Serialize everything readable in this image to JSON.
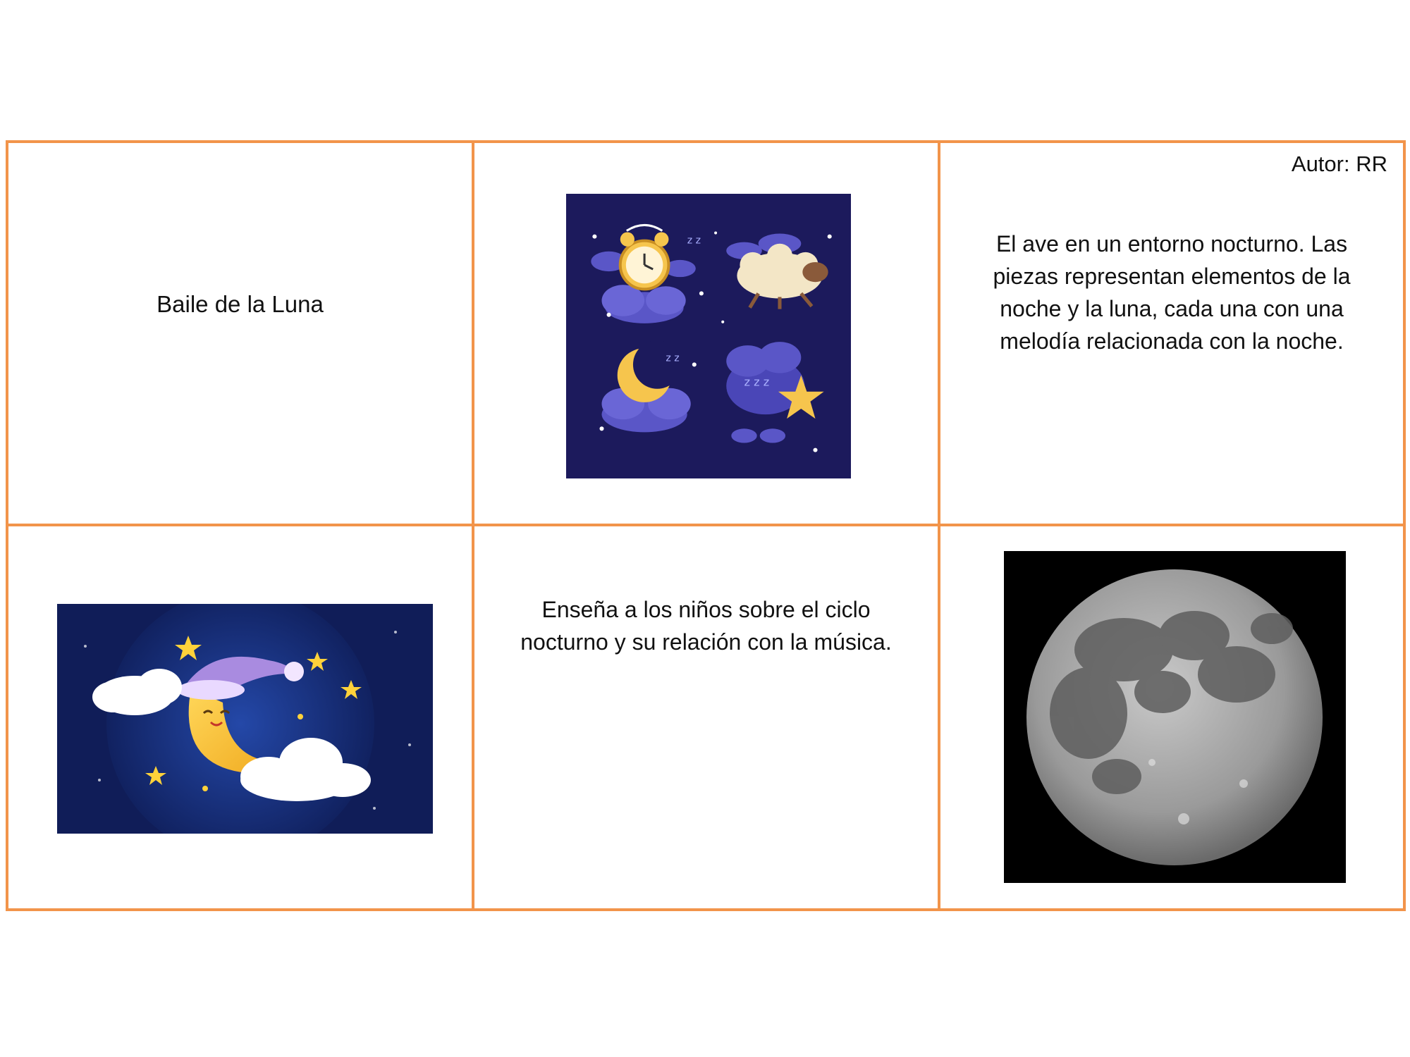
{
  "cards": {
    "title": "Baile de la Luna",
    "author": "Autor: RR",
    "description": "El ave en un entorno nocturno. Las piezas representan elementos de la noche y la luna, cada una con una melodía relacionada con la noche.",
    "lesson": "Enseña a los niños sobre el ciclo nocturno y su relación con la música."
  },
  "colors": {
    "border": "#f2944a",
    "night_panel": "#1c1a5c",
    "moon_photo_bg": "#000000"
  },
  "images": {
    "night_icons": "night-icons-illustration",
    "sleepy_moon": "sleepy-moon-3d-illustration",
    "full_moon": "full-moon-photograph"
  }
}
